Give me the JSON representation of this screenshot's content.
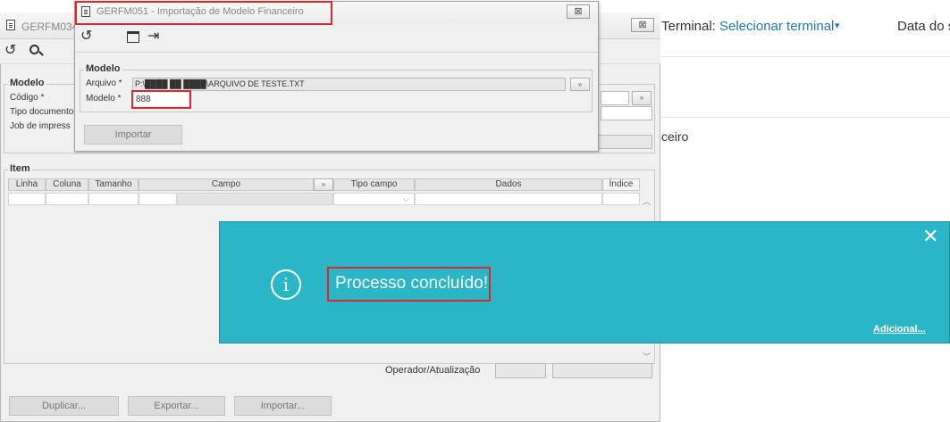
{
  "web": {
    "terminal_label": "Terminal:",
    "terminal_link": "Selecionar terminal",
    "caret": "▾",
    "date_label": "Data do s",
    "breadcrumb_tail": "ceiro"
  },
  "back_window": {
    "title": "GERFM034",
    "close_label": "⊠",
    "group_modelo": "Modelo",
    "codigo_label": "Código *",
    "tipo_doc_label": "Tipo documento",
    "job_label": "Job de impress",
    "group_item": "Item",
    "columns": [
      "Linha",
      "Coluna",
      "Tamanho",
      "Campo",
      "Tipo campo",
      "Dados",
      "Índice"
    ],
    "operador_label": "Operador/Atualização",
    "buttons": {
      "duplicar": "Duplicar...",
      "exportar": "Exportar...",
      "importar": "Importar..."
    }
  },
  "dialog": {
    "title": "GERFM051 - Importação de Modelo Financeiro",
    "close_label": "⊠",
    "group_label": "Modelo",
    "arquivo_label": "Arquivo *",
    "arquivo_value": "P:\\████ ██ ████\\ARQUIVO DE TESTE.TXT",
    "modelo_label": "Modelo *",
    "modelo_value": "888",
    "importar_button": "Importar"
  },
  "toast": {
    "message": "Processo concluído!",
    "more_link": "Adicional...",
    "close_glyph": "✕",
    "info_glyph": "i"
  },
  "colors": {
    "toast_bg": "#2ab6c7",
    "highlight": "#d9292b",
    "link": "#1f7ab8"
  }
}
